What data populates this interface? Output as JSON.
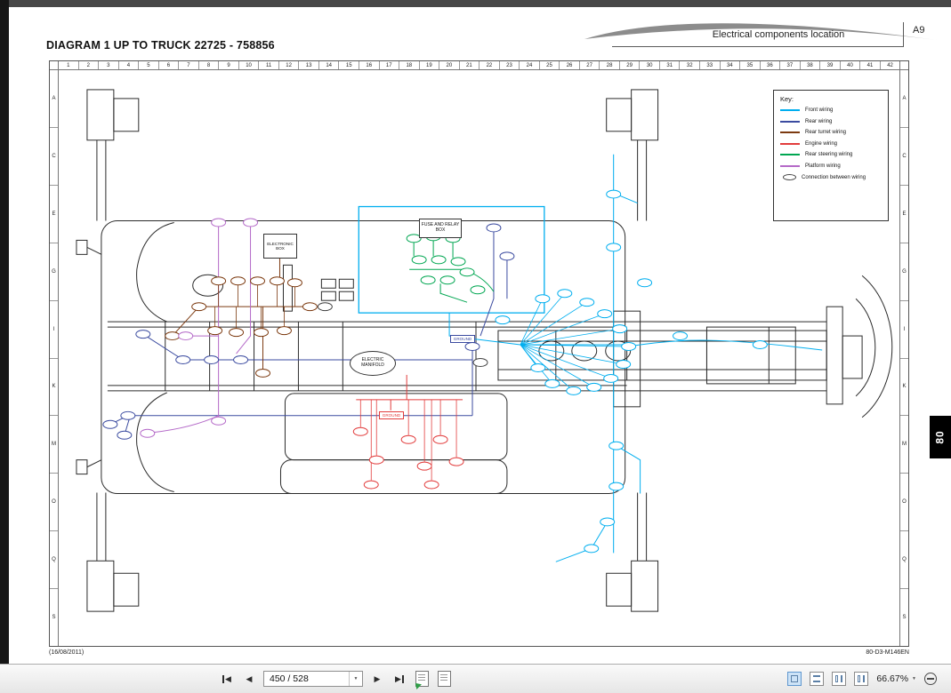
{
  "header": {
    "page_title": "DIAGRAM 1 UP TO TRUCK 22725 - 758856",
    "section_title": "Electrical components location",
    "corner_code": "A9"
  },
  "sheet": {
    "columns": [
      "1",
      "2",
      "3",
      "4",
      "5",
      "6",
      "7",
      "8",
      "9",
      "10",
      "11",
      "12",
      "13",
      "14",
      "15",
      "16",
      "17",
      "18",
      "19",
      "20",
      "21",
      "22",
      "23",
      "24",
      "25",
      "26",
      "27",
      "28",
      "29",
      "30",
      "31",
      "32",
      "33",
      "34",
      "35",
      "36",
      "37",
      "38",
      "39",
      "40",
      "41",
      "42"
    ],
    "rows": [
      "A",
      "C",
      "E",
      "G",
      "I",
      "K",
      "M",
      "O",
      "Q",
      "S"
    ],
    "key": {
      "title": "Key:",
      "items": [
        {
          "label": "Front wiring",
          "color": "#00AEEF"
        },
        {
          "label": "Rear wiring",
          "color": "#3B4BA0"
        },
        {
          "label": "Rear turret wiring",
          "color": "#7C3A10"
        },
        {
          "label": "Engine wiring",
          "color": "#E23C3C"
        },
        {
          "label": "Rear steering wiring",
          "color": "#00A651"
        },
        {
          "label": "Platform wiring",
          "color": "#B469C8"
        },
        {
          "label": "Connection between wiring",
          "color": "#444444",
          "symbol": "oval"
        }
      ]
    },
    "labels": {
      "fuse_box": "FUSE AND RELAY BOX",
      "electronic_box": "ELECTRONIC BOX",
      "electric_manifold": "ELECTRIC MANIFOLD",
      "ground": "GROUND"
    },
    "footer_left": "(16/08/2011)",
    "footer_right": "80-D3-M146EN",
    "side_tab": "80"
  },
  "toolbar": {
    "page_value": "450 / 528",
    "zoom_value": "66.67%"
  }
}
